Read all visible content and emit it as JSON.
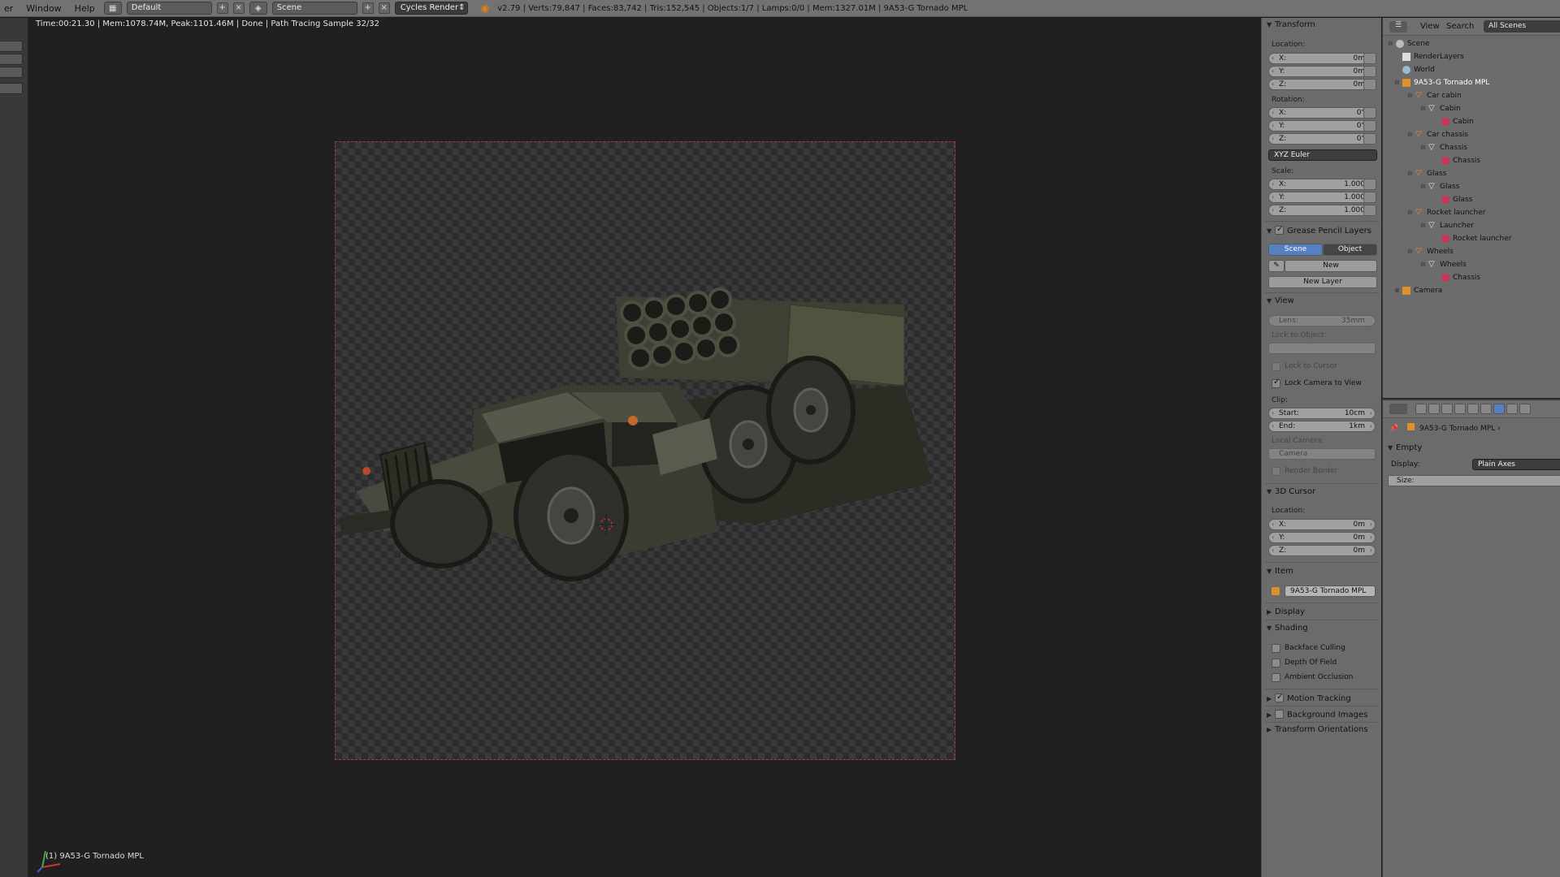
{
  "topbar": {
    "menus": [
      "er",
      "Window",
      "Help"
    ],
    "layout": "Default",
    "scene": "Scene",
    "engine": "Cycles Render",
    "stats": "v2.79 | Verts:79,847 | Faces:83,742 | Tris:152,545 | Objects:1/7 | Lamps:0/0 | Mem:1327.01M | 9A53-G Tornado MPL"
  },
  "viewport": {
    "render_info": "Time:00:21.30 | Mem:1078.74M, Peak:1101.46M | Done | Path Tracing Sample 32/32",
    "object_label": "(1) 9A53-G Tornado MPL"
  },
  "npanel": {
    "transform": {
      "title": "Transform",
      "location_label": "Location:",
      "location": [
        {
          "axis": "X:",
          "value": "0m"
        },
        {
          "axis": "Y:",
          "value": "0m"
        },
        {
          "axis": "Z:",
          "value": "0m"
        }
      ],
      "rotation_label": "Rotation:",
      "rotation": [
        {
          "axis": "X:",
          "value": "0°"
        },
        {
          "axis": "Y:",
          "value": "0°"
        },
        {
          "axis": "Z:",
          "value": "0°"
        }
      ],
      "rotation_mode": "XYZ Euler",
      "scale_label": "Scale:",
      "scale": [
        {
          "axis": "X:",
          "value": "1.000"
        },
        {
          "axis": "Y:",
          "value": "1.000"
        },
        {
          "axis": "Z:",
          "value": "1.000"
        }
      ]
    },
    "grease_pencil": {
      "title": "Grease Pencil Layers",
      "tab_scene": "Scene",
      "tab_object": "Object",
      "new_label": "New",
      "new_layer_label": "New Layer"
    },
    "view": {
      "title": "View",
      "lens": "Lens:",
      "lens_value": "35mm",
      "lock_to_object": "Lock to Object:",
      "lock_to_cursor": "Lock to Cursor",
      "lock_camera": "Lock Camera to View",
      "clip_label": "Clip:",
      "clip_start_label": "Start:",
      "clip_start": "10cm",
      "clip_end_label": "End:",
      "clip_end": "1km",
      "local_camera": "Local Camera:",
      "camera": "Camera",
      "render_border": "Render Border"
    },
    "cursor": {
      "title": "3D Cursor",
      "location_label": "Location:",
      "location": [
        {
          "axis": "X:",
          "value": "0m"
        },
        {
          "axis": "Y:",
          "value": "0m"
        },
        {
          "axis": "Z:",
          "value": "0m"
        }
      ]
    },
    "item": {
      "title": "Item",
      "name": "9A53-G Tornado MPL"
    },
    "display": {
      "title": "Display"
    },
    "shading": {
      "title": "Shading",
      "backface": "Backface Culling",
      "dof": "Depth Of Field",
      "ao": "Ambient Occlusion"
    },
    "motion_tracking": "Motion Tracking",
    "background_images": "Background Images",
    "transform_orientations": "Transform Orientations"
  },
  "outliner": {
    "view": "View",
    "search": "Search",
    "filter": "All Scenes",
    "rows": [
      {
        "label": "Scene"
      },
      {
        "label": "RenderLayers"
      },
      {
        "label": "World"
      },
      {
        "label": "9A53-G Tornado MPL"
      },
      {
        "label": "Car cabin"
      },
      {
        "label": "Cabin"
      },
      {
        "label": "Cabin"
      },
      {
        "label": "Car chassis"
      },
      {
        "label": "Chassis"
      },
      {
        "label": "Chassis"
      },
      {
        "label": "Glass"
      },
      {
        "label": "Glass"
      },
      {
        "label": "Glass"
      },
      {
        "label": "Rocket launcher"
      },
      {
        "label": "Launcher"
      },
      {
        "label": "Rocket launcher"
      },
      {
        "label": "Wheels"
      },
      {
        "label": "Wheels"
      },
      {
        "label": "Chassis"
      },
      {
        "label": "Camera"
      }
    ]
  },
  "properties": {
    "breadcrumb": "9A53-G Tornado MPL",
    "panel_title": "Empty",
    "display_label": "Display:",
    "display_value": "Plain Axes",
    "size_label": "Size:"
  },
  "colors": {
    "accent": "#5680c2",
    "camera_border": "#a43a3a"
  }
}
